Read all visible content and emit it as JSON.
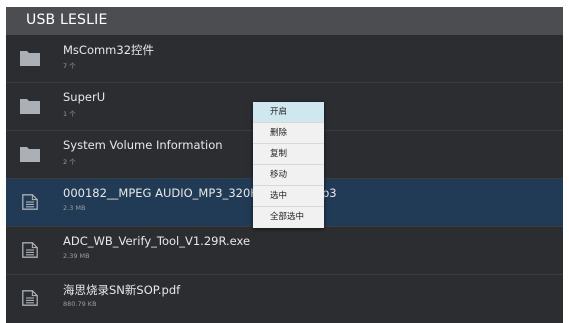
{
  "header": {
    "title": "USB LESLIE"
  },
  "files": [
    {
      "name": "MsComm32控件",
      "meta": "7 个",
      "icon": "folder-icon"
    },
    {
      "name": "SuperU",
      "meta": "1 个",
      "icon": "folder-icon"
    },
    {
      "name": "System Volume Information",
      "meta": "2 个",
      "icon": "folder-icon"
    },
    {
      "name": "000182__MPEG AUDIO_MP3_320Kbp",
      "name_tail": "p3",
      "meta": "2.3 MB",
      "icon": "file-icon"
    },
    {
      "name": "ADC_WB_Verify_Tool_V1.29R.exe",
      "meta": "2.39 MB",
      "icon": "file-icon"
    },
    {
      "name": "海思烧录SN新SOP.pdf",
      "meta": "880.79 KB",
      "icon": "file-icon"
    }
  ],
  "context_menu": {
    "items": [
      "开启",
      "删除",
      "复制",
      "移动",
      "选中",
      "全部选中"
    ]
  },
  "colors": {
    "background": "#2b2d31",
    "titlebar": "#4b4d51",
    "selected_row": "#213a55",
    "menu_highlight": "#cfe7ef",
    "icon": "#aab0b6"
  }
}
